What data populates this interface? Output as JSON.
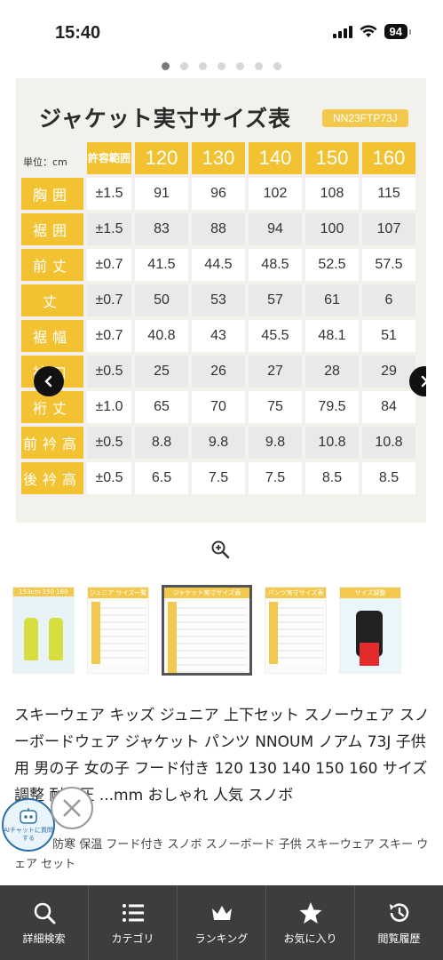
{
  "status": {
    "time": "15:40",
    "battery": "94"
  },
  "carousel": {
    "dot_count": 7,
    "active_index": 0
  },
  "size_chart_image": {
    "title": "ジャケット実寸サイズ表",
    "model": "NN23FTP73J",
    "unit_label": "単位：cm",
    "tolerance_header": "許容範囲",
    "sizes": [
      "120",
      "130",
      "140",
      "150",
      "160"
    ],
    "rows": [
      {
        "label": "胸囲",
        "tolerance": "±1.5",
        "values": [
          "91",
          "96",
          "102",
          "108",
          "115"
        ]
      },
      {
        "label": "裾囲",
        "tolerance": "±1.5",
        "values": [
          "83",
          "88",
          "94",
          "100",
          "107"
        ]
      },
      {
        "label": "前丈",
        "tolerance": "±0.7",
        "values": [
          "41.5",
          "44.5",
          "48.5",
          "52.5",
          "57.5"
        ]
      },
      {
        "label": "丈",
        "tolerance": "±0.7",
        "values": [
          "50",
          "53",
          "57",
          "61",
          "6"
        ]
      },
      {
        "label": "裾幅",
        "tolerance": "±0.7",
        "values": [
          "40.8",
          "43",
          "45.5",
          "48.1",
          "51"
        ]
      },
      {
        "label": "袖口",
        "tolerance": "±0.5",
        "values": [
          "25",
          "26",
          "27",
          "28",
          "29"
        ]
      },
      {
        "label": "裄丈",
        "tolerance": "±1.0",
        "values": [
          "65",
          "70",
          "75",
          "79.5",
          "84"
        ]
      },
      {
        "label": "前衿高",
        "tolerance": "±0.5",
        "values": [
          "8.8",
          "9.8",
          "9.8",
          "10.8",
          "10.8"
        ]
      },
      {
        "label": "後衿高",
        "tolerance": "±0.5",
        "values": [
          "6.5",
          "7.5",
          "7.5",
          "8.5",
          "8.5"
        ]
      }
    ]
  },
  "thumbnails": [
    {
      "label": "153cm 150 160"
    },
    {
      "label": "ジュニア サイズ一覧"
    },
    {
      "label": "ジャケット実寸サイズ表"
    },
    {
      "label": "パンツ実寸サイズ表"
    },
    {
      "label": "サイズ調整"
    }
  ],
  "product": {
    "title": "スキーウェア キッズ ジュニア 上下セット スノーウェア スノーボードウェア ジャケット パンツ NNOUM ノアム 73J 子供用 男の子 女の子 フード付き 120 130 140 150 160 サイズ調整 耐水圧 ...mm おしゃれ 人気 スノボ",
    "subdesc": "ウエア 防寒 保温 フード付き スノボ スノーボード 子供 スキーウェア スキー ウェア セット"
  },
  "ai_chat": {
    "label": "AIチャットに質問する"
  },
  "bottom_nav": [
    {
      "label": "詳細検索",
      "icon": "search-icon"
    },
    {
      "label": "カテゴリ",
      "icon": "list-icon"
    },
    {
      "label": "ランキング",
      "icon": "crown-icon"
    },
    {
      "label": "お気に入り",
      "icon": "star-icon"
    },
    {
      "label": "閲覧履歴",
      "icon": "history-icon"
    }
  ]
}
